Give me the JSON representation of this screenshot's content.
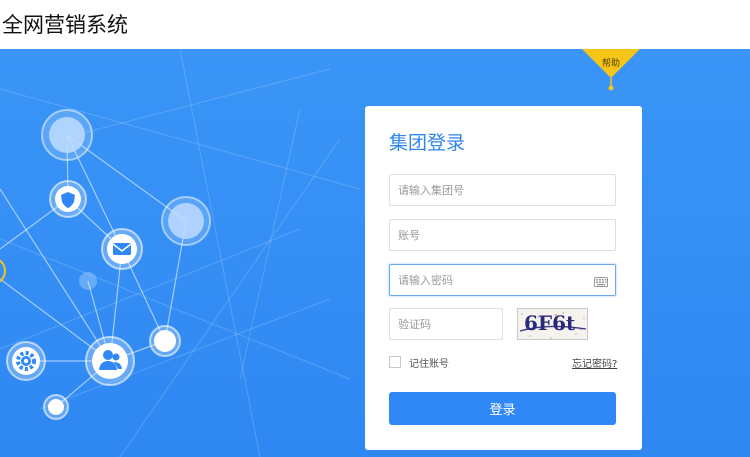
{
  "app": {
    "title": "全网营销系统"
  },
  "help": {
    "label": "帮助"
  },
  "login": {
    "title": "集团登录",
    "group_placeholder": "请输入集团号",
    "account_placeholder": "账号",
    "password_placeholder": "请输入密码",
    "captcha_placeholder": "验证码",
    "captcha_text": "6F6t",
    "remember_label": "记住账号",
    "forgot_label": "忘记密码?",
    "submit_label": "登录"
  },
  "colors": {
    "brand_blue": "#2f88f5",
    "hero_blue": "#3a95f7",
    "help_yellow": "#f5c518"
  },
  "icons": [
    "shield-icon",
    "mail-icon",
    "gear-icon",
    "user-icon",
    "keyboard-icon",
    "checkbox-icon"
  ]
}
